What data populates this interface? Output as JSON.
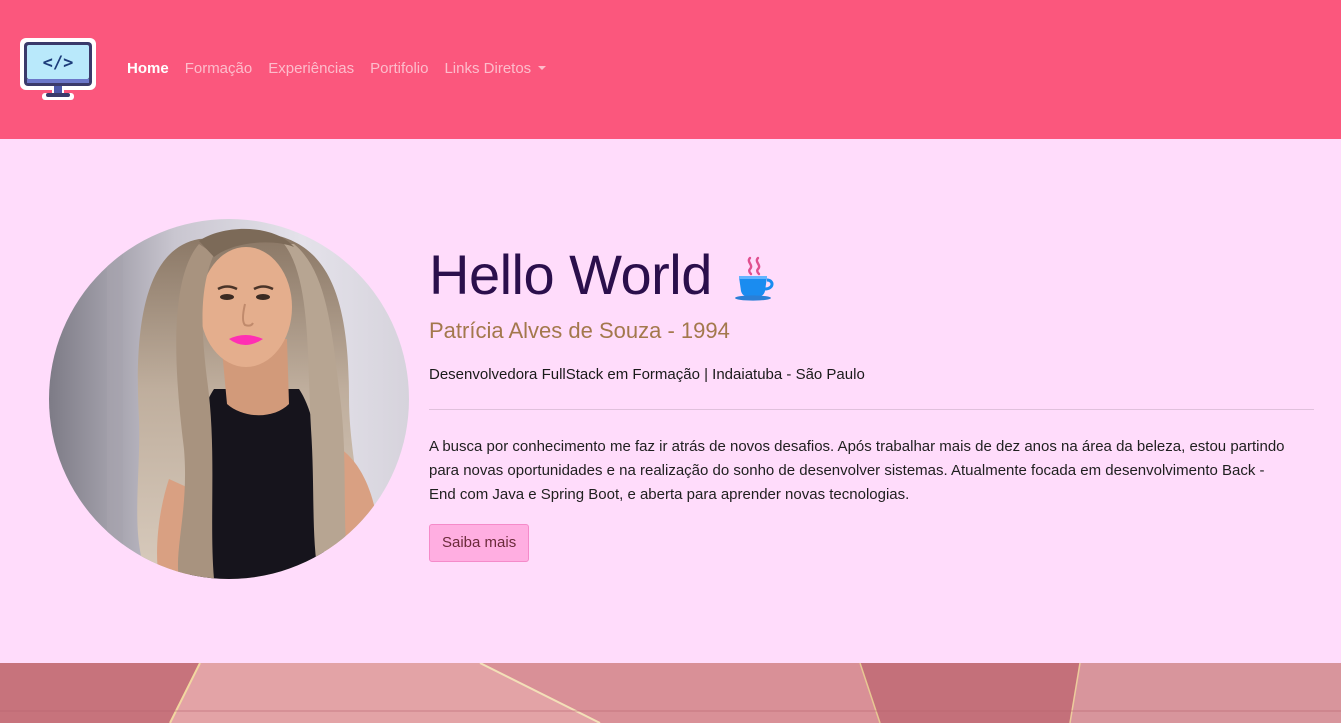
{
  "nav": {
    "logo_icon": "code-monitor-icon",
    "logo_text": "</>",
    "items": [
      {
        "label": "Home",
        "active": true
      },
      {
        "label": "Formação",
        "active": false
      },
      {
        "label": "Experiências",
        "active": false
      },
      {
        "label": "Portifolio",
        "active": false
      },
      {
        "label": "Links Diretos",
        "active": false,
        "dropdown": true
      }
    ]
  },
  "hero": {
    "photo_icon": "profile-photo",
    "title": "Hello World",
    "title_icon": "hot-coffee-icon",
    "subtitle": "Patrícia Alves de Souza - 1994",
    "role": "Desenvolvedora FullStack em Formação | Indaiatuba - São Paulo",
    "bio": "A busca por conhecimento me faz ir atrás de novos desafios. Após trabalhar mais de dez anos na área da beleza, estou partindo para novas oportunidades e na realização do sonho de desenvolver sistemas. Atualmente focada em desenvolvimento Back -End com Java e Spring Boot, e aberta para aprender novas tecnologias.",
    "button_label": "Saiba mais"
  },
  "colors": {
    "navbar": "#fb577d",
    "hero_bg": "#ffdcfb",
    "title": "#2b0f4c",
    "subtitle": "#a3784c",
    "button_bg": "#ffaee1"
  }
}
